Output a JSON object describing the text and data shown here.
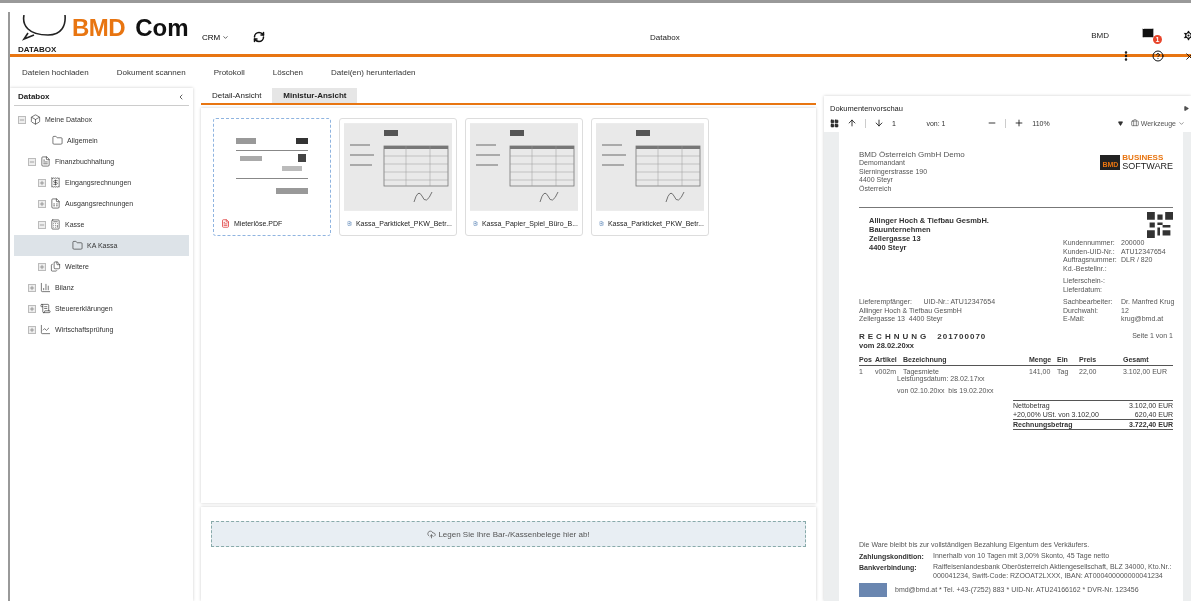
{
  "header": {
    "logo_brand": "BMD",
    "logo_product": "Com",
    "module": "DATABOX",
    "menu": "CRM",
    "title": "Databox",
    "user": "BMD",
    "mail_badge": "1"
  },
  "actions": [
    "Dateien hochladen",
    "Dokument scannen",
    "Protokoll",
    "Löschen",
    "Datei(en) herunterladen"
  ],
  "sidebar": {
    "title": "Databox",
    "tree": [
      {
        "label": "Meine Databox",
        "kind": "root",
        "expanded": true,
        "selected": false,
        "children": [
          {
            "label": "Allgemein",
            "kind": "folder",
            "selected": false
          },
          {
            "label": "Finanzbuchhaltung",
            "kind": "ledger",
            "expanded": true,
            "selected": false,
            "children": [
              {
                "label": "Eingangsrechnungen",
                "kind": "incoming",
                "expanded": false,
                "selected": false
              },
              {
                "label": "Ausgangsrechnungen",
                "kind": "outgoing",
                "expanded": false,
                "selected": false
              },
              {
                "label": "Kasse",
                "kind": "register",
                "expanded": true,
                "selected": false,
                "children": [
                  {
                    "label": "KA Kassa",
                    "kind": "folder",
                    "selected": true
                  }
                ]
              },
              {
                "label": "Weitere",
                "kind": "more",
                "expanded": false,
                "selected": false
              }
            ]
          },
          {
            "label": "Bilanz",
            "kind": "balance",
            "expanded": false,
            "selected": false
          },
          {
            "label": "Steuererklärungen",
            "kind": "tax",
            "expanded": false,
            "selected": false
          },
          {
            "label": "Wirtschaftsprüfung",
            "kind": "audit",
            "expanded": false,
            "selected": false
          }
        ]
      }
    ]
  },
  "tabs": [
    {
      "label": "Detail-Ansicht",
      "selected": false
    },
    {
      "label": "Ministur-Ansicht",
      "selected": true
    }
  ],
  "files": [
    {
      "name": "Mieterlöse.PDF",
      "kind": "pdf",
      "selected": true
    },
    {
      "name": "Kassa_Parkticket_PKW_Betr...",
      "kind": "image",
      "selected": false
    },
    {
      "name": "Kassa_Papier_Spiel_Büro_B...",
      "kind": "image",
      "selected": false
    },
    {
      "name": "Kassa_Parkticket_PKW_Betr...",
      "kind": "image",
      "selected": false
    }
  ],
  "dropzone": "Legen Sie Ihre Bar-/Kassenbelege hier ab!",
  "preview": {
    "title": "Dokumentenvorschau",
    "page": "1",
    "page_total": "von: 1",
    "zoom": "110%",
    "tools": "Werkzeuge",
    "document": {
      "sender_name": "BMD Österreich GmbH Demo",
      "sender_lines": [
        "Demomandant",
        "Sierningerstrasse 190",
        "4400 Steyr",
        "Österreich"
      ],
      "logo_top": "BUSINESS",
      "logo_bottom": "SOFTWARE",
      "logo_mark": "BMD",
      "recipient": [
        "Allinger Hoch & Tiefbau GesmbH.",
        "Bauunternehmen",
        "Zellergasse 13",
        "4400 Steyr"
      ],
      "info": [
        {
          "label": "Kundennummer:",
          "value": "200000"
        },
        {
          "label": "Kunden-UID-Nr.:",
          "value": "ATU12347654"
        },
        {
          "label": "Auftragsnummer:",
          "value": "DLR / 820"
        },
        {
          "label": "Kd.-Bestellnr.:"
        },
        {
          "label": "Lieferschein-:"
        },
        {
          "label": "Lieferdatum:"
        }
      ],
      "delivery": [
        "Lieferempfänger:      UID-Nr.: ATU12347654",
        "Allinger Hoch & Tiefbau GesmbH",
        "Zellergasse 13  4400 Steyr"
      ],
      "contact": [
        {
          "label": "Sachbearbeiter:",
          "value": "Dr. Manfred Krug"
        },
        {
          "label": "Durchwahl:",
          "value": "12"
        },
        {
          "label": "E-Mail:",
          "value": "krug@bmd.at"
        }
      ],
      "doc_title": "RECHNUNG",
      "doc_number": "201700070",
      "doc_date": "vom 28.02.20xx",
      "page_info": "Seite 1 von 1",
      "columns": [
        "Pos",
        "Artikel",
        "Bezeichnung",
        "Menge",
        "Ein",
        "Preis",
        "Gesamt"
      ],
      "rows": [
        [
          "1",
          "v002m",
          "Tagesmiete",
          "141,00",
          "Tag",
          "22,00",
          "3.102,00 EUR"
        ]
      ],
      "row_notes": [
        "Leistungsdatum: 28.02.17xx",
        "von 02.10.20xx  bis 19.02.20xx"
      ],
      "totals": [
        {
          "label": "Nettobetrag",
          "value": "3.102,00 EUR",
          "kind": "plain"
        },
        {
          "label": "+20,00% USt. von 3.102,00",
          "value": "620,40 EUR",
          "kind": "plain"
        },
        {
          "label": "Rechnungsbetrag",
          "value": "3.722,40 EUR",
          "kind": "total"
        }
      ],
      "note": "Die Ware bleibt bis zur vollständigen Bezahlung Eigentum des Verkäufers.",
      "terms": [
        {
          "label": "Zahlungskondition:",
          "value": "Innerhalb von 10 Tagen mit 3,00% Skonto, 45 Tage netto"
        },
        {
          "label": "Bankverbindung:",
          "value": "Raiffeisenlandesbank Oberösterreich Aktiengesellschaft,  BLZ 34000, Kto.Nr.: 000041234, Swift-Code: RZOOAT2LXXX, IBAN: AT000400000000041234"
        }
      ],
      "footer": "bmd@bmd.at  *  Tel. +43-(7252) 883  *  UID-Nr. ATU24166162  *  DVR-Nr. 123456"
    }
  }
}
